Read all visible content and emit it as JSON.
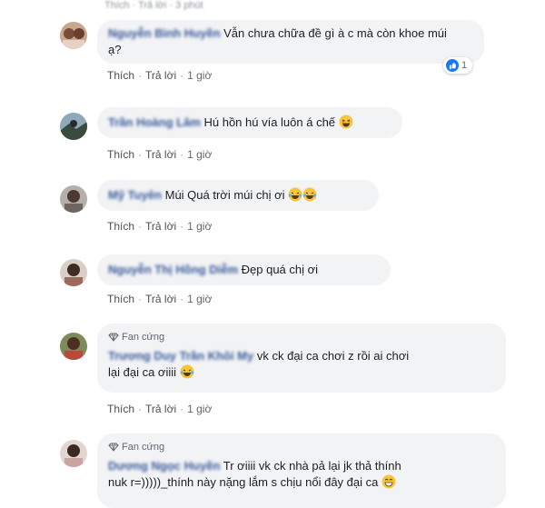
{
  "top_fade": "Thích · Trả lời · 3 phút",
  "comments": [
    {
      "name": "Nguyễn Bình Huyền",
      "text_line1": "Vẫn chưa chữa đề gì à c mà còn khoe múi",
      "text_line2": "ạ?",
      "like": "Thích",
      "reply": "Trả lời",
      "time": "1 giờ",
      "reaction_count": "1"
    },
    {
      "name": "Trần Hoàng Lâm",
      "text": "Hú hồn hú vía luôn á chế",
      "like": "Thích",
      "reply": "Trả lời",
      "time": "1 giờ"
    },
    {
      "name": "Mỹ Tuyên",
      "text": "Múi Quá trời múi chị ơi",
      "like": "Thích",
      "reply": "Trả lời",
      "time": "1 giờ"
    },
    {
      "name": "Nguyễn Thị Hồng Diễm",
      "text": "Đẹp quá chị ơi",
      "like": "Thích",
      "reply": "Trả lời",
      "time": "1 giờ"
    },
    {
      "badge": "Fan cứng",
      "name": "Trương Duy Trần Khôi My",
      "text_line1": "vk ck đại ca chơi z rồi ai chơi",
      "text_line2": "lại đại ca ơiiii",
      "like": "Thích",
      "reply": "Trả lời",
      "time": "1 giờ"
    },
    {
      "badge": "Fan cứng",
      "name": "Dương Ngọc Huyền",
      "text_line1": "Tr ơiiii vk ck nhà pả lại jk thả thính",
      "text_line2": "nuk r=)))))_thính này nặng lắm s chịu nổi đây đại ca"
    }
  ]
}
